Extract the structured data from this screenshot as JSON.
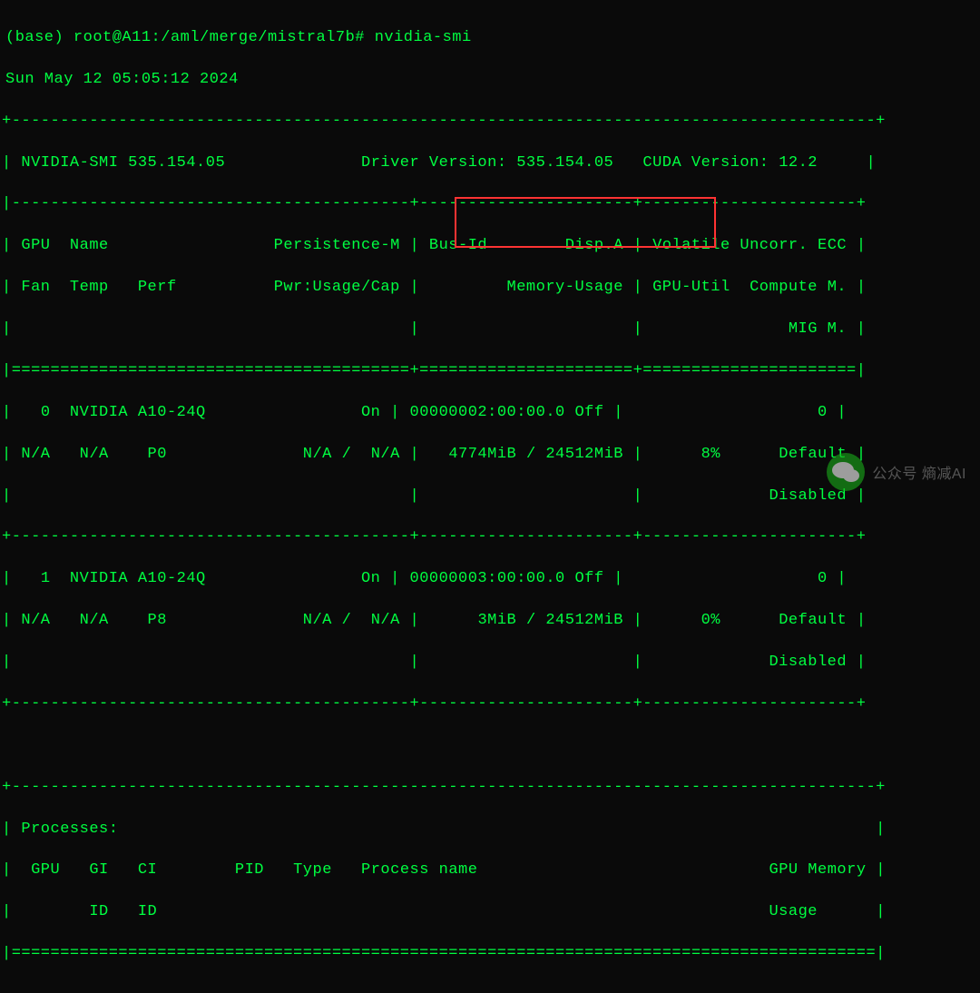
{
  "prompt": {
    "env": "(base)",
    "user_host": "root@A11",
    "path": ":/aml/merge/mistral7b#",
    "command": "nvidia-smi"
  },
  "datetime": "Sun May 12 05:05:12 2024",
  "header": {
    "smi_version_label": "NVIDIA-SMI",
    "smi_version": "535.154.05",
    "driver_label": "Driver Version:",
    "driver_version": "535.154.05",
    "cuda_label": "CUDA Version:",
    "cuda_version": "12.2"
  },
  "columns": {
    "row1": {
      "gpu": "GPU",
      "name": "Name",
      "persistence": "Persistence-M",
      "busid": "Bus-Id",
      "disp": "Disp.A",
      "volatile": "Volatile",
      "uncorr_ecc": "Uncorr. ECC"
    },
    "row2": {
      "fan": "Fan",
      "temp": "Temp",
      "perf": "Perf",
      "pwr": "Pwr:Usage/Cap",
      "memory": "Memory-Usage",
      "gpu_util": "GPU-Util",
      "compute": "Compute M."
    },
    "row3": {
      "mig": "MIG M."
    }
  },
  "gpus": [
    {
      "index": "0",
      "name": "NVIDIA A10-24Q",
      "persistence": "On",
      "bus_id": "00000002:00:00.0",
      "disp": "Off",
      "ecc": "0",
      "fan": "N/A",
      "temp": "N/A",
      "perf": "P0",
      "pwr_usage": "N/A",
      "pwr_cap": "N/A",
      "mem_used": "4774MiB",
      "mem_total": "24512MiB",
      "util": "8%",
      "compute": "Default",
      "mig": "Disabled"
    },
    {
      "index": "1",
      "name": "NVIDIA A10-24Q",
      "persistence": "On",
      "bus_id": "00000003:00:00.0",
      "disp": "Off",
      "ecc": "0",
      "fan": "N/A",
      "temp": "N/A",
      "perf": "P8",
      "pwr_usage": "N/A",
      "pwr_cap": "N/A",
      "mem_used": "3MiB",
      "mem_total": "24512MiB",
      "util": "0%",
      "compute": "Default",
      "mig": "Disabled"
    }
  ],
  "processes": {
    "title": "Processes:",
    "col_gpu": "GPU",
    "col_gi": "GI",
    "col_ci": "CI",
    "col_pid": "PID",
    "col_type": "Type",
    "col_pname": "Process name",
    "col_gpumem": "GPU Memory",
    "col_id": "ID",
    "col_usage": "Usage"
  },
  "watermark": {
    "label": "公众号",
    "name": "熵减AI"
  }
}
